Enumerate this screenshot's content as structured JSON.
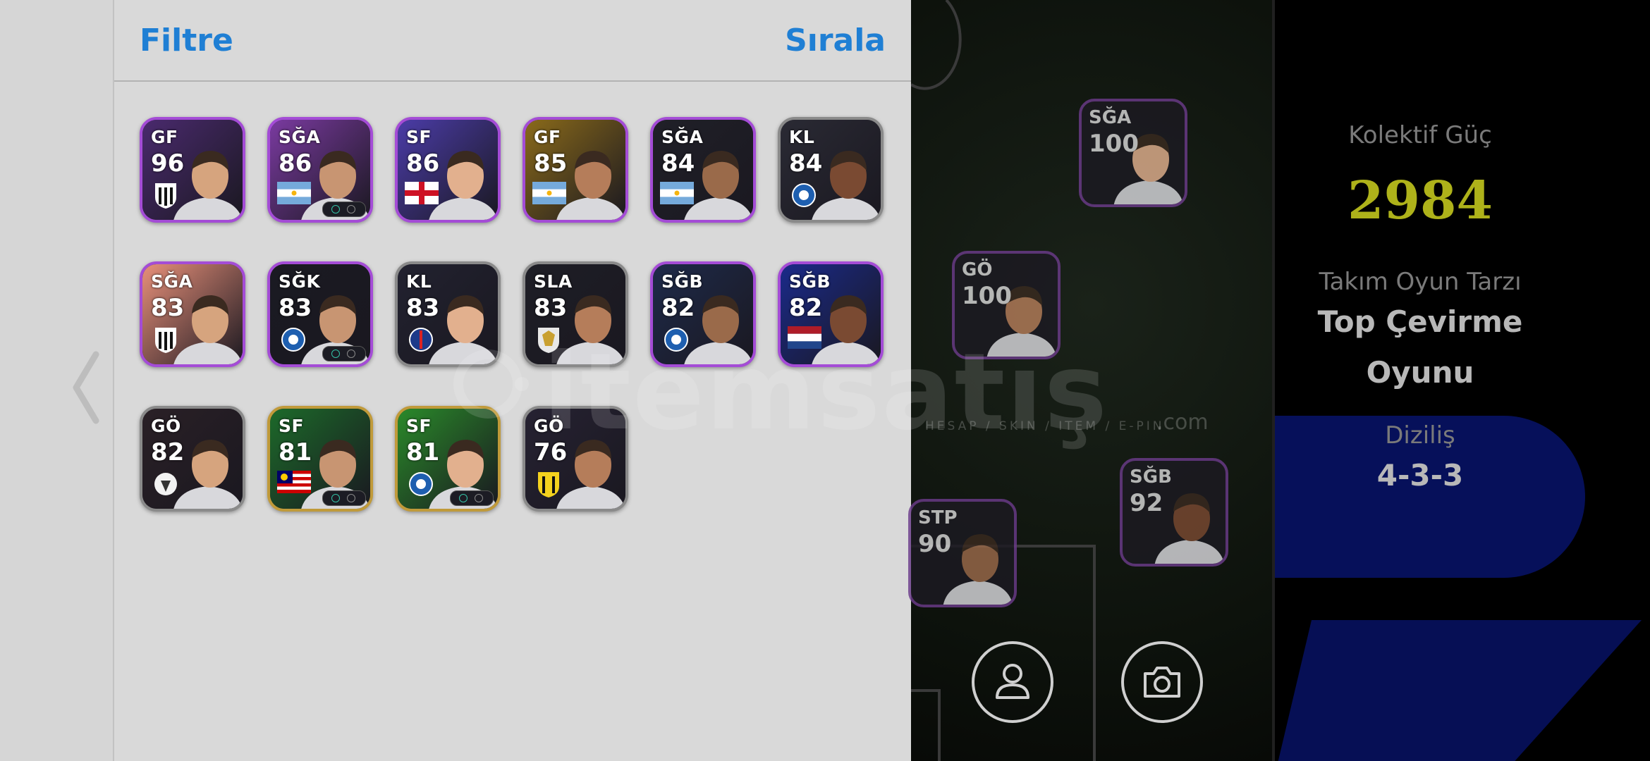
{
  "panel": {
    "filter_label": "Filtre",
    "sort_label": "Sırala"
  },
  "cards": [
    {
      "pos": "GF",
      "rating": "96",
      "frame": "purple",
      "bg": "#4a2a6e",
      "extra": "badge-stripes"
    },
    {
      "pos": "SĞA",
      "rating": "86",
      "frame": "purple",
      "bg": "#7a3aa0",
      "extra": "flag-argentina",
      "skill": true
    },
    {
      "pos": "SF",
      "rating": "86",
      "frame": "purple",
      "bg": "#4b3ca8",
      "extra": "flag-england"
    },
    {
      "pos": "GF",
      "rating": "85",
      "frame": "purple",
      "bg": "#8a6a1a",
      "extra": "flag-argentina"
    },
    {
      "pos": "SĞA",
      "rating": "84",
      "frame": "purple",
      "bg": "#202028",
      "extra": "flag-argentina"
    },
    {
      "pos": "KL",
      "rating": "84",
      "frame": "gray",
      "bg": "#2a2a34",
      "extra": "badge-blue-circle"
    },
    {
      "pos": "SĞA",
      "rating": "83",
      "frame": "purple",
      "bg": "#e8907a",
      "extra": "badge-stripes"
    },
    {
      "pos": "SĞK",
      "rating": "83",
      "frame": "purple",
      "bg": "#1a1a22",
      "extra": "badge-blue-circle",
      "skill": true
    },
    {
      "pos": "KL",
      "rating": "83",
      "frame": "gray",
      "bg": "#222230",
      "extra": "badge-psg"
    },
    {
      "pos": "SLA",
      "rating": "83",
      "frame": "gray",
      "bg": "#1e1e26",
      "extra": "badge-gold"
    },
    {
      "pos": "SĞB",
      "rating": "82",
      "frame": "purple",
      "bg": "#1e2a4a",
      "extra": "badge-blue-circle"
    },
    {
      "pos": "SĞB",
      "rating": "82",
      "frame": "purple",
      "bg": "#1a2a8a",
      "extra": "flag-netherlands"
    },
    {
      "pos": "GÖ",
      "rating": "82",
      "frame": "gray",
      "bg": "#2a2026",
      "extra": "badge-white"
    },
    {
      "pos": "SF",
      "rating": "81",
      "frame": "gold",
      "bg": "#1c6a2a",
      "extra": "flag-malaysia",
      "skill": true
    },
    {
      "pos": "SF",
      "rating": "81",
      "frame": "gold",
      "bg": "#2a8a2a",
      "extra": "badge-blue-circle",
      "skill": true
    },
    {
      "pos": "GÖ",
      "rating": "76",
      "frame": "gray",
      "bg": "#262232",
      "extra": "badge-yellow"
    }
  ],
  "pitch_cards": [
    {
      "pos": "SĞA",
      "rating": "100"
    },
    {
      "pos": "GÖ",
      "rating": "100"
    },
    {
      "pos": "STP",
      "rating": "90"
    },
    {
      "pos": "SĞB",
      "rating": "92"
    }
  ],
  "info": {
    "collective_label": "Kolektif Güç",
    "collective_value": "2984",
    "style_label": "Takım Oyun Tarzı",
    "style_value_line1": "Top Çevirme",
    "style_value_line2": "Oyunu",
    "formation_label": "Diziliş",
    "formation_value": "4-3-3"
  },
  "watermark": {
    "text": "itemsatış",
    "sub": "HESAP / SKIN / ITEM / E-PIN",
    "dotcom": ".com"
  },
  "colors": {
    "accent_blue": "#1f7fd4",
    "collective_yellow": "#aeb21a",
    "frame_purple": "#a44cd6",
    "frame_gray": "#8a8a8a",
    "frame_gold": "#c09a3a"
  }
}
